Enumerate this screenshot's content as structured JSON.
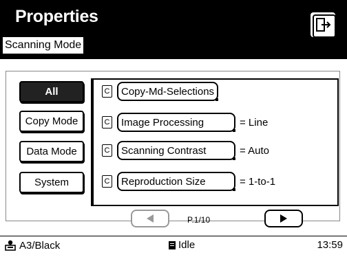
{
  "header": {
    "title": "Properties",
    "subtitle": "Scanning Mode",
    "exit_icon": "exit-door-icon"
  },
  "categories": [
    {
      "label": "All",
      "active": true
    },
    {
      "label": "Copy Mode",
      "active": false
    },
    {
      "label": "Data Mode",
      "active": false
    },
    {
      "label": "System",
      "active": false
    }
  ],
  "items": [
    {
      "icon_letter": "C",
      "label": "Copy-Md-Selections",
      "value": ""
    },
    {
      "icon_letter": "C",
      "label": "Image Processing",
      "value": "= Line"
    },
    {
      "icon_letter": "C",
      "label": "Scanning Contrast",
      "value": "= Auto"
    },
    {
      "icon_letter": "C",
      "label": "Reproduction Size",
      "value": "= 1-to-1"
    }
  ],
  "pager": {
    "label": "P.1/10",
    "prev_icon": "triangle-left-icon",
    "next_icon": "triangle-right-icon"
  },
  "status": {
    "paper": "A3/Black",
    "state": "Idle",
    "time": "13:59"
  }
}
